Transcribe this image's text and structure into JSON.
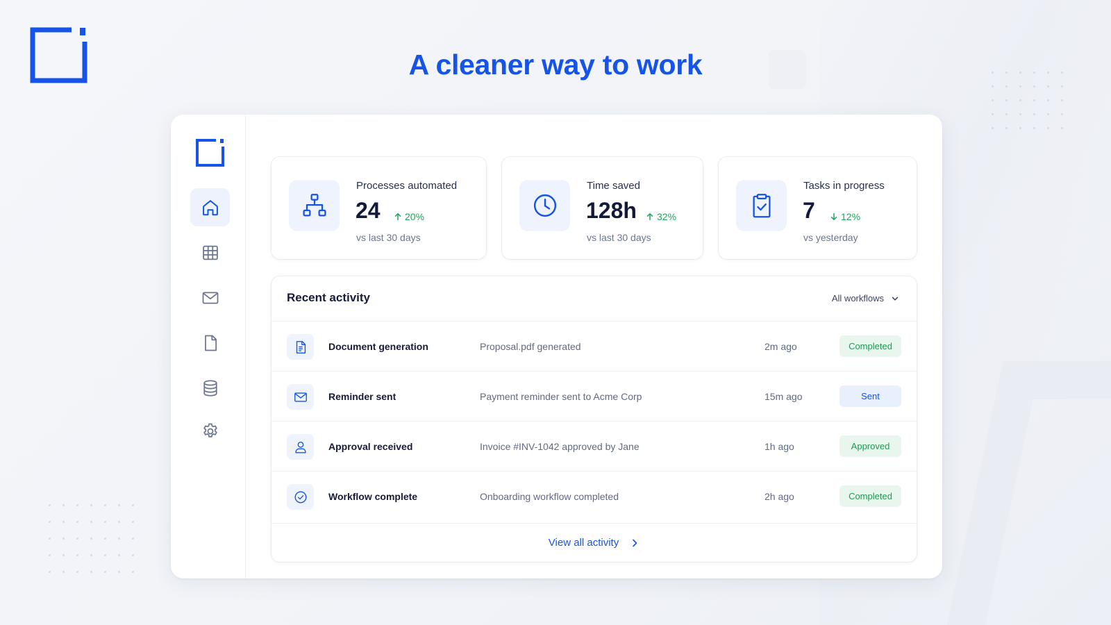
{
  "headline": "A cleaner way to work",
  "colors": {
    "brand_blue": "#1554e6",
    "positive_green": "#1fa65c",
    "background": "#f3f5f9"
  },
  "sidebar": {
    "items": [
      {
        "icon": "home-icon",
        "active": true
      },
      {
        "icon": "table-icon",
        "active": false
      },
      {
        "icon": "mail-icon",
        "active": false
      },
      {
        "icon": "document-icon",
        "active": false
      },
      {
        "icon": "database-icon",
        "active": false
      },
      {
        "icon": "settings-icon",
        "active": false
      }
    ]
  },
  "stats": [
    {
      "icon": "workflow-icon",
      "label": "Processes automated",
      "value": "24",
      "delta": "20%",
      "direction": "up",
      "sub": "vs last 30 days"
    },
    {
      "icon": "clock-icon",
      "label": "Time saved",
      "value": "128h",
      "delta": "32%",
      "direction": "up",
      "sub": "vs last 30 days"
    },
    {
      "icon": "clipboard-check-icon",
      "label": "Tasks in progress",
      "value": "7",
      "delta": "12%",
      "direction": "down",
      "sub": "vs yesterday"
    }
  ],
  "activity": {
    "title": "Recent activity",
    "filter": "All workflows",
    "rows": [
      {
        "icon": "document-icon",
        "name": "Document generation",
        "description": "Proposal.pdf generated",
        "time": "2m ago",
        "status": "Completed",
        "status_color": "green"
      },
      {
        "icon": "mail-icon",
        "name": "Reminder sent",
        "description": "Payment reminder sent to Acme Corp",
        "time": "15m ago",
        "status": "Sent",
        "status_color": "blue"
      },
      {
        "icon": "user-icon",
        "name": "Approval received",
        "description": "Invoice #INV-1042 approved by Jane",
        "time": "1h ago",
        "status": "Approved",
        "status_color": "green"
      },
      {
        "icon": "check-circle-icon",
        "name": "Workflow complete",
        "description": "Onboarding workflow completed",
        "time": "2h ago",
        "status": "Completed",
        "status_color": "green"
      }
    ],
    "view_all": "View all activity"
  }
}
